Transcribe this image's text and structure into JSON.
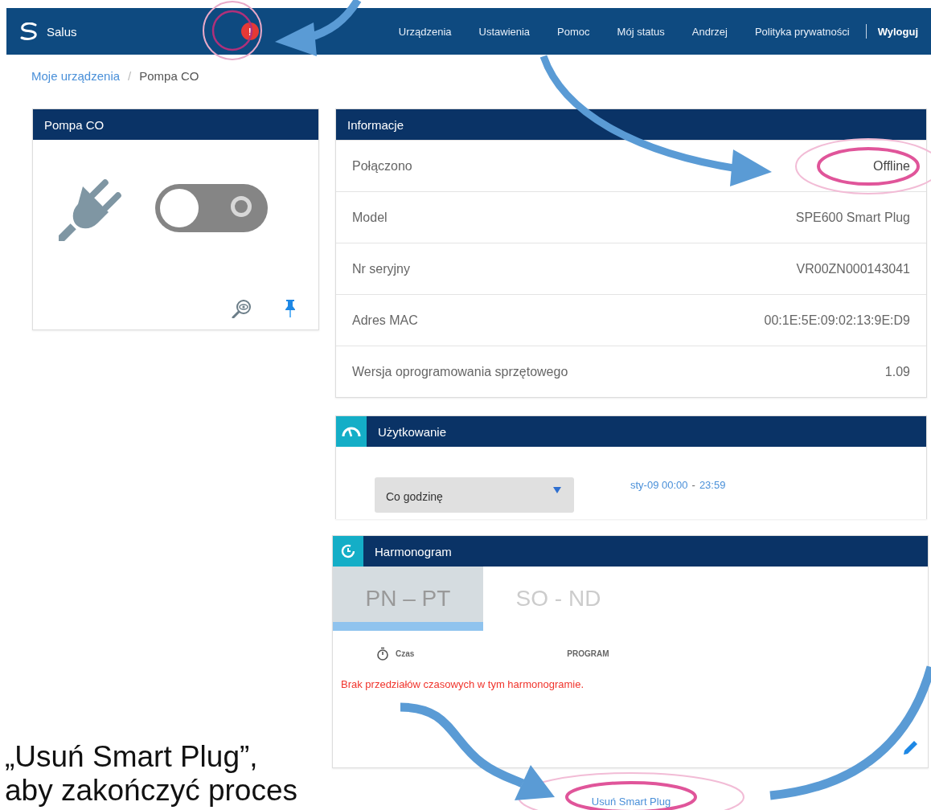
{
  "nav": {
    "brand": "Salus",
    "alert": "!",
    "items": [
      {
        "label": "Urządzenia"
      },
      {
        "label": "Ustawienia"
      },
      {
        "label": "Pomoc"
      },
      {
        "label": "Mój status"
      },
      {
        "label": "Andrzej"
      },
      {
        "label": "Polityka prywatności"
      }
    ],
    "logout": "Wyloguj"
  },
  "breadcrumb": {
    "link": "Moje urządzenia",
    "separator": "/",
    "current": "Pompa CO"
  },
  "device_card": {
    "title": "Pompa CO",
    "toggle": {
      "on": false
    }
  },
  "info": {
    "title": "Informacje",
    "rows": [
      {
        "label": "Połączono",
        "value": "Offline",
        "highlighted": true
      },
      {
        "label": "Model",
        "value": "SPE600 Smart Plug",
        "highlighted": false
      },
      {
        "label": "Nr seryjny",
        "value": "VR00ZN000143041",
        "highlighted": false
      },
      {
        "label": "Adres MAC",
        "value": "00:1E:5E:09:02:13:9E:D9",
        "highlighted": false
      },
      {
        "label": "Wersja oprogramowania sprzętowego",
        "value": "1.09",
        "highlighted": false
      }
    ]
  },
  "usage": {
    "title": "Użytkowanie",
    "interval": "Co godzinę",
    "range_from": "sty-09 00:00",
    "range_sep": "-",
    "range_to": "23:59"
  },
  "schedule": {
    "title": "Harmonogram",
    "tabs": [
      {
        "label": "PN – PT",
        "selected": true
      },
      {
        "label": "SO - ND",
        "selected": false
      }
    ],
    "columns": [
      "Czas",
      "PROGRAM"
    ],
    "empty_message": "Brak przedziałów czasowych w tym harmonogramie."
  },
  "delete_link": "Usuń Smart Plug",
  "caption": [
    "„Usuń Smart Plug”,",
    "aby zakończyć proces"
  ]
}
